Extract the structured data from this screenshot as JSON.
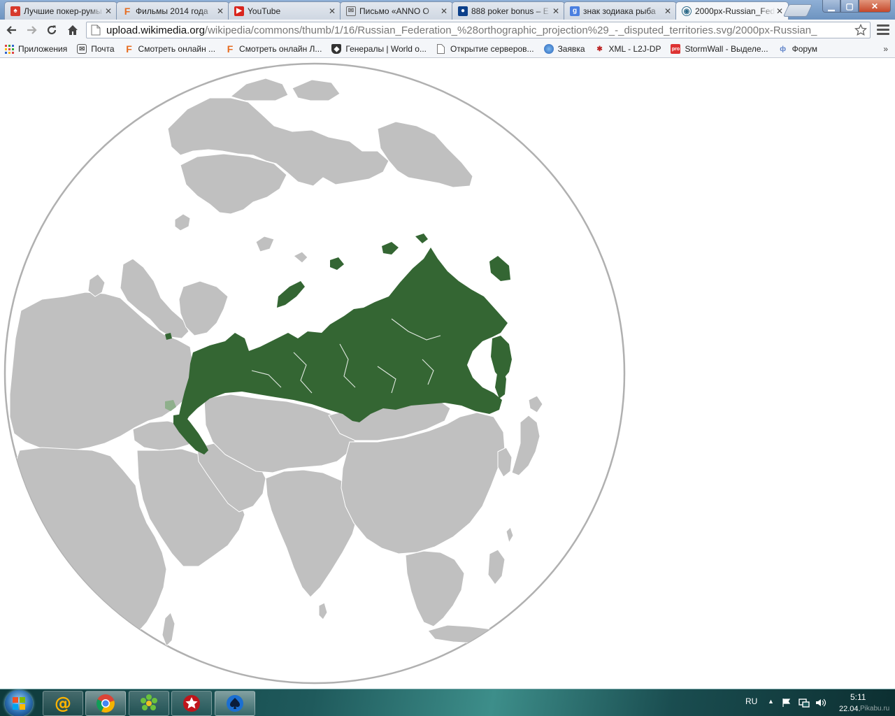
{
  "browser": {
    "tabs": [
      {
        "title": "Лучшие покер-румы",
        "favicon": "poker-site-icon",
        "color": "#d7392b"
      },
      {
        "title": "Фильмы 2014 года",
        "favicon": "f-site-icon",
        "color": "#e66b1e"
      },
      {
        "title": "YouTube",
        "favicon": "youtube-icon",
        "color": "#d9251d"
      },
      {
        "title": "Письмо «ANNO O",
        "favicon": "mail-icon",
        "color": "#666666"
      },
      {
        "title": "888 poker bonus – E",
        "favicon": "888-icon",
        "color": "#0b3f8a"
      },
      {
        "title": "знак зодиака рыба",
        "favicon": "google-icon",
        "color": "#4a7fe0"
      },
      {
        "title": "2000px-Russian_Fed",
        "favicon": "wikimedia-icon",
        "color": "#2d6a89"
      }
    ],
    "url_host": "upload.wikimedia.org",
    "url_path": "/wikipedia/commons/thumb/1/16/Russian_Federation_%28orthographic_projection%29_-_disputed_territories.svg/2000px-Russian_",
    "bookmarks": [
      {
        "label": "Приложения",
        "icon": "apps-grid-icon"
      },
      {
        "label": "Почта",
        "icon": "mail-icon"
      },
      {
        "label": "Смотреть онлайн ...",
        "icon": "f-site-icon"
      },
      {
        "label": "Смотреть онлайн Л...",
        "icon": "f-site-icon"
      },
      {
        "label": "Генералы | World o...",
        "icon": "shield-icon"
      },
      {
        "label": "Открытие серверов...",
        "icon": "page-icon"
      },
      {
        "label": "Заявка",
        "icon": "globe-icon"
      },
      {
        "label": "XML - L2J-DP",
        "icon": "paw-icon"
      },
      {
        "label": "StormWall - Выделе...",
        "icon": "stormwall-icon"
      },
      {
        "label": "Форум",
        "icon": "forum-icon"
      }
    ],
    "more": "»"
  },
  "map": {
    "highlight_color": "#346633",
    "land_color": "#c0c0c0",
    "border_color": "#ffffff",
    "sphere_outline": "#b0b0b0"
  },
  "taskbar": {
    "apps": [
      "mail-ru-agent-icon",
      "chrome-icon",
      "icq-icon",
      "pokerstars-icon",
      "poker-client-icon"
    ],
    "tray": {
      "lang": "RU",
      "time": "5:11",
      "date": "22.04.",
      "watermark": "Pikabu.ru"
    }
  }
}
